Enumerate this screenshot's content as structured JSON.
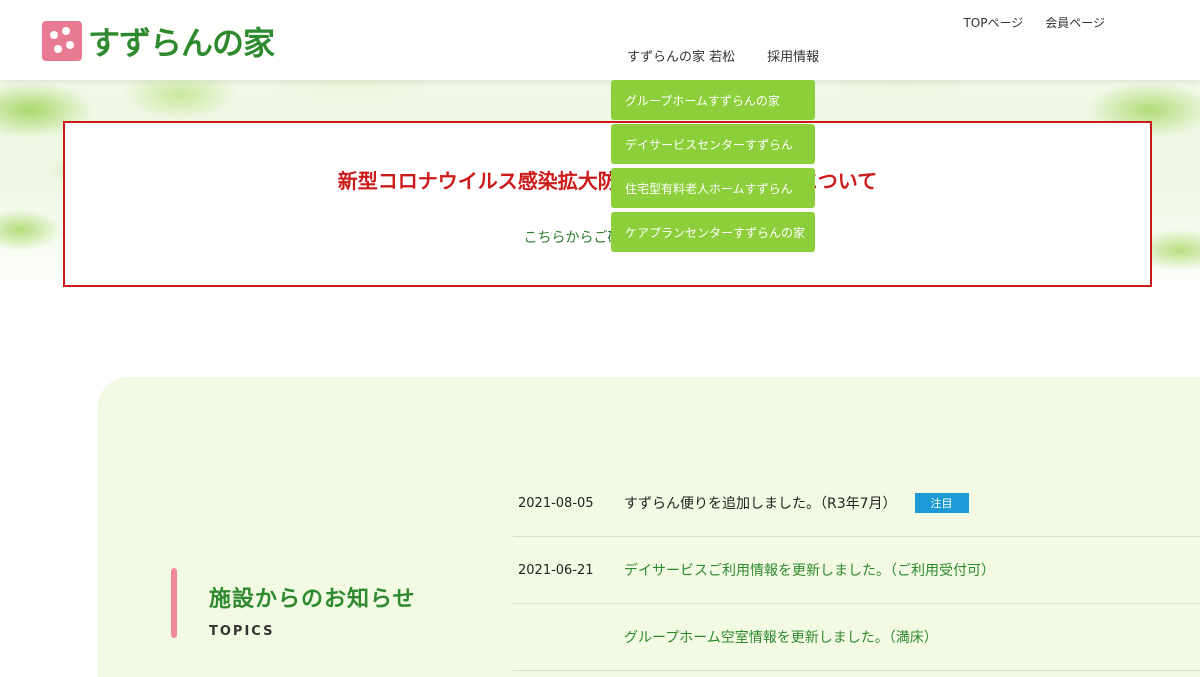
{
  "header": {
    "logo_text": "すずらんの家",
    "top_links": [
      "TOPページ",
      "会員ページ"
    ],
    "main_nav": [
      "すずらんの家 若松",
      "採用情報"
    ],
    "dropdown": [
      "グループホームすずらんの家",
      "デイサービスセンターすずらん",
      "住宅型有料老人ホームすずらん",
      "ケアプランセンターすずらんの家"
    ]
  },
  "notice": {
    "title": "新型コロナウイルス感染拡大防止に伴う入館再規制について",
    "link": "こちらからご確認ください"
  },
  "section": {
    "title": "施設からのお知らせ",
    "subtitle": "TOPICS"
  },
  "news": [
    {
      "date": "2021-08-05",
      "text": "すずらん便りを追加しました。（R3年7月）",
      "badge": "注目"
    },
    {
      "date": "2021-06-21",
      "text": "デイサービスご利用情報を更新しました。（ご利用受付可）"
    },
    {
      "date": "",
      "text": "グループホーム空室情報を更新しました。（満床）"
    }
  ],
  "colors": {
    "accent_green": "#2f8a2f",
    "dropdown_green": "#8ccf3a",
    "notice_red": "#cc1a1a",
    "badge_blue": "#1b9ad6"
  }
}
